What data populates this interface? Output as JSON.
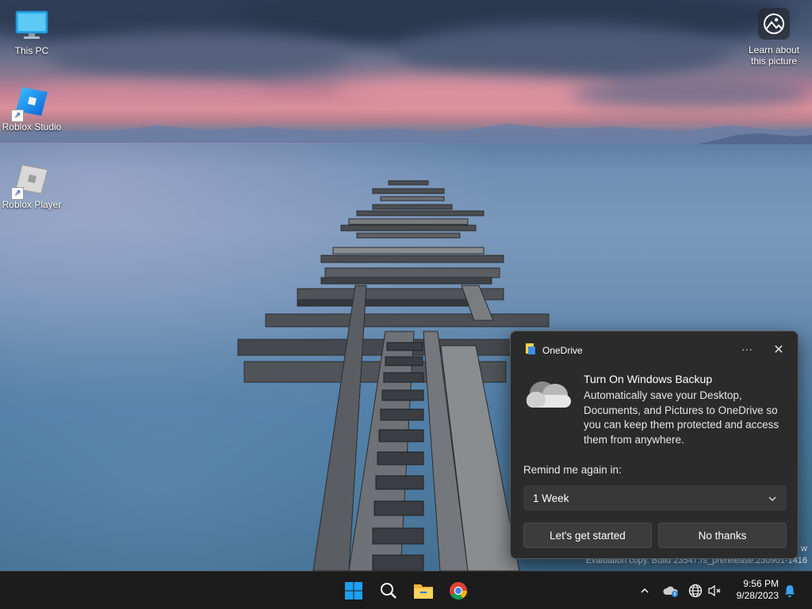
{
  "desktop": {
    "icons": [
      {
        "label": "This PC",
        "icon": "monitor-icon"
      },
      {
        "label": "Roblox Studio",
        "icon": "roblox-studio-icon"
      },
      {
        "label": "Roblox Player",
        "icon": "roblox-player-icon"
      }
    ],
    "learn_about_picture": "Learn about\nthis picture",
    "watermark": {
      "line1": "w",
      "line2": "Evaluation copy. Build 23547.rs_prerelease.230901-1416"
    }
  },
  "toast": {
    "app_name": "OneDrive",
    "more_label": "···",
    "close_label": "✕",
    "title": "Turn On Windows Backup",
    "body": "Automatically save your Desktop, Documents, and Pictures to OneDrive so you can keep them protected and access them from anywhere.",
    "remind_label": "Remind me again in:",
    "remind_selected": "1 Week",
    "primary_button": "Let's get started",
    "secondary_button": "No thanks"
  },
  "taskbar": {
    "apps": [
      "windows-start-icon",
      "search-icon",
      "file-explorer-icon",
      "chrome-icon"
    ],
    "tray": [
      "chevron-up-icon",
      "onedrive-cloud-icon",
      "network-globe-icon",
      "volume-muted-icon"
    ],
    "time": "9:56 PM",
    "date": "9/28/2023",
    "notification_icon": "bell-icon"
  },
  "colors": {
    "toast_bg": "#2b2b2b",
    "taskbar_bg": "#1c1c1c",
    "windows_blue": "#0a84e4"
  }
}
